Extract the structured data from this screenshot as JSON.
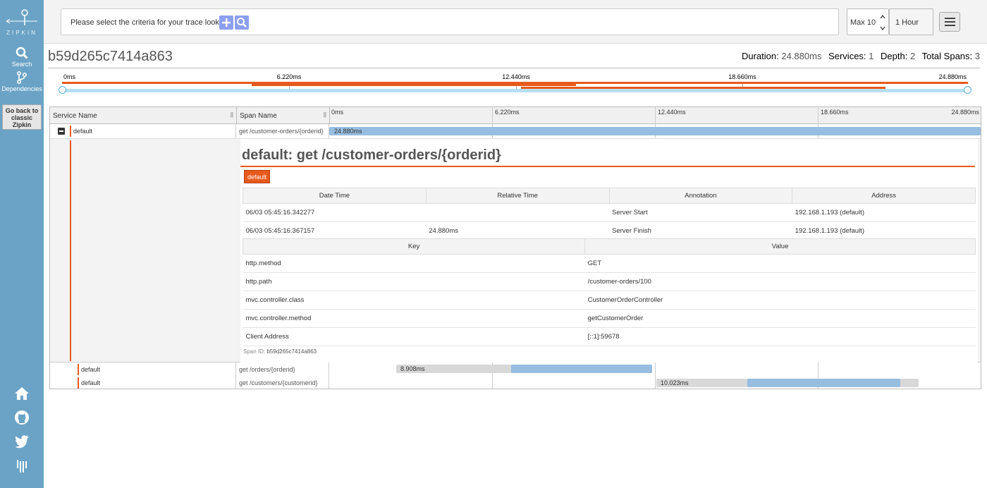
{
  "sidebar": {
    "logo_text": "ZIPKIN",
    "search_label": "Search",
    "dependencies_label": "Dependencies",
    "classic_label": "Go back to classic Zipkin"
  },
  "search": {
    "placeholder_text": "Please select the criteria for your trace lookup.",
    "limit": "Max 10",
    "lookback": "1 Hour"
  },
  "trace": {
    "id": "b59d265c7414a863",
    "summary": {
      "duration_label": "Duration:",
      "duration": "24.880ms",
      "services_label": "Services:",
      "services": "1",
      "depth_label": "Depth:",
      "depth": "2",
      "spans_label": "Total Spans:",
      "spans": "3"
    }
  },
  "timeline": {
    "ticks": [
      "0ms",
      "6.220ms",
      "12.440ms",
      "18.660ms",
      "24.880ms"
    ],
    "col_service": "Service Name",
    "col_span": "Span Name",
    "spans": [
      {
        "service": "default",
        "name": "get /customer-orders/{orderid}",
        "duration": "24.880ms",
        "start": 0,
        "end": 24.88,
        "depth": 0
      },
      {
        "service": "default",
        "name": "get /orders/{orderid}",
        "duration": "8.908ms",
        "start": 5.2,
        "end": 14.108,
        "depth": 1
      },
      {
        "service": "default",
        "name": "get /customers/{customerid}",
        "duration": "10.023ms",
        "start": 12.6,
        "end": 22.623,
        "depth": 1
      }
    ]
  },
  "detail": {
    "title": "default: get /customer-orders/{orderid}",
    "service_badge": "default",
    "annotation_headers": [
      "Date Time",
      "Relative Time",
      "Annotation",
      "Address"
    ],
    "annotations": [
      [
        "06/03 05:45:16.342277",
        "",
        "Server Start",
        "192.168.1.193 (default)"
      ],
      [
        "06/03 05:45:16.367157",
        "24.880ms",
        "Server Finish",
        "192.168.1.193 (default)"
      ]
    ],
    "tag_headers": [
      "Key",
      "Value"
    ],
    "tags": [
      [
        "http.method",
        "GET"
      ],
      [
        "http.path",
        "/customer-orders/100"
      ],
      [
        "mvc.controller.class",
        "CustomerOrderController"
      ],
      [
        "mvc.controller.method",
        "getCustomerOrder"
      ],
      [
        "Client Address",
        "[::1]:59678"
      ]
    ],
    "span_id_label": "Span ID:",
    "span_id": "b59d265c7414a863"
  },
  "colors": {
    "sidebar": "#6aa3c6",
    "accent": "#e85a1b",
    "span_bar": "#97bde0"
  }
}
